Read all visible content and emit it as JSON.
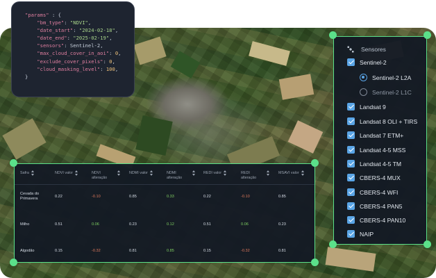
{
  "code": {
    "lines": [
      [
        {
          "t": "\"params\"",
          "c": "k"
        },
        {
          "t": " : {",
          "c": "p"
        }
      ],
      [
        {
          "t": "    \"bm_type\"",
          "c": "k"
        },
        {
          "t": ": ",
          "c": "p"
        },
        {
          "t": "\"NDVI\"",
          "c": "s"
        },
        {
          "t": ",",
          "c": "p"
        }
      ],
      [
        {
          "t": "    \"date_start\"",
          "c": "k"
        },
        {
          "t": ": ",
          "c": "p"
        },
        {
          "t": "\"2024-02-18\"",
          "c": "s"
        },
        {
          "t": ",",
          "c": "p"
        }
      ],
      [
        {
          "t": "    \"date_end\"",
          "c": "k"
        },
        {
          "t": ": ",
          "c": "p"
        },
        {
          "t": "\"2025-02-19\"",
          "c": "s"
        },
        {
          "t": ",",
          "c": "p"
        }
      ],
      [
        {
          "t": "    \"sensors\"",
          "c": "k"
        },
        {
          "t": ": Sentinel-2,",
          "c": "p"
        }
      ],
      [
        {
          "t": "    \"max_cloud_cover_in_aoi\"",
          "c": "k"
        },
        {
          "t": ": ",
          "c": "p"
        },
        {
          "t": "0",
          "c": "n"
        },
        {
          "t": ",",
          "c": "p"
        }
      ],
      [
        {
          "t": "    \"exclude_cover_pixels\"",
          "c": "k"
        },
        {
          "t": ": ",
          "c": "p"
        },
        {
          "t": "0",
          "c": "n"
        },
        {
          "t": ",",
          "c": "p"
        }
      ],
      [
        {
          "t": "    \"cloud_masking_level\"",
          "c": "k"
        },
        {
          "t": ": ",
          "c": "p"
        },
        {
          "t": "100",
          "c": "n"
        },
        {
          "t": ",",
          "c": "p"
        }
      ],
      [
        {
          "t": "}",
          "c": "p"
        }
      ]
    ]
  },
  "sensors": {
    "title": "Sensores",
    "items": [
      {
        "label": "Sentinel-2",
        "type": "checkbox",
        "checked": true
      },
      {
        "label": "Sentinel-2 L2A",
        "type": "radio",
        "checked": true
      },
      {
        "label": "Sentinel-2 L1C",
        "type": "radio",
        "checked": false
      },
      {
        "label": "Landsat 9",
        "type": "checkbox",
        "checked": true
      },
      {
        "label": "Landsat 8 OLI + TIRS",
        "type": "checkbox",
        "checked": true
      },
      {
        "label": "Landsat 7 ETM+",
        "type": "checkbox",
        "checked": true
      },
      {
        "label": "Landsat 4-5 MSS",
        "type": "checkbox",
        "checked": true
      },
      {
        "label": "Landsat 4-5 TM",
        "type": "checkbox",
        "checked": true
      },
      {
        "label": "CBERS-4 MUX",
        "type": "checkbox",
        "checked": true
      },
      {
        "label": "CBERS-4 WFI",
        "type": "checkbox",
        "checked": true
      },
      {
        "label": "CBERS-4 PAN5",
        "type": "checkbox",
        "checked": true
      },
      {
        "label": "CBERS-4 PAN10",
        "type": "checkbox",
        "checked": true
      },
      {
        "label": "NAIP",
        "type": "checkbox",
        "checked": true
      }
    ]
  },
  "table": {
    "headers": [
      "Safra",
      "NDVI valor",
      "NDVI alteração",
      "NDMI valor",
      "NDMI alteração",
      "REDI valor",
      "REDI alteração",
      "MSAVI valor"
    ],
    "rows": [
      {
        "cells": [
          "Cevada do Primavera",
          "0.22",
          "-0.10",
          "0.85",
          "0.33",
          "0.22",
          "-0.10",
          "0.85"
        ]
      },
      {
        "cells": [
          "Milho",
          "0.51",
          "0.06",
          "0.23",
          "0.12",
          "0.51",
          "0.06",
          "0.23"
        ]
      },
      {
        "cells": [
          "Algodão",
          "0.15",
          "-0.32",
          "0.81",
          "0.85",
          "0.15",
          "-0.32",
          "0.81"
        ]
      }
    ]
  },
  "colors": {
    "accent": "#5be08a",
    "checkbox": "#5aa5e6",
    "negative": "#e0795c",
    "positive": "#7fcf62"
  }
}
